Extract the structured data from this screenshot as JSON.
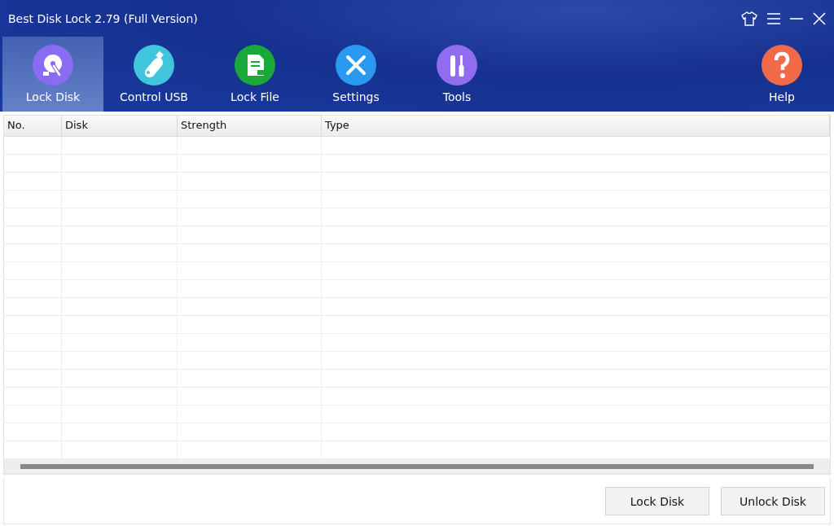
{
  "window": {
    "title": "Best Disk Lock 2.79 (Full Version)"
  },
  "tabs": [
    {
      "label": "Lock Disk",
      "selected": true
    },
    {
      "label": "Control USB",
      "selected": false
    },
    {
      "label": "Lock File",
      "selected": false
    },
    {
      "label": "Settings",
      "selected": false
    },
    {
      "label": "Tools",
      "selected": false
    }
  ],
  "help": {
    "label": "Help"
  },
  "table": {
    "columns": [
      "No.",
      "Disk",
      "Strength",
      "Type"
    ]
  },
  "buttons": [
    "Lock Disk",
    "Unlock Disk"
  ]
}
